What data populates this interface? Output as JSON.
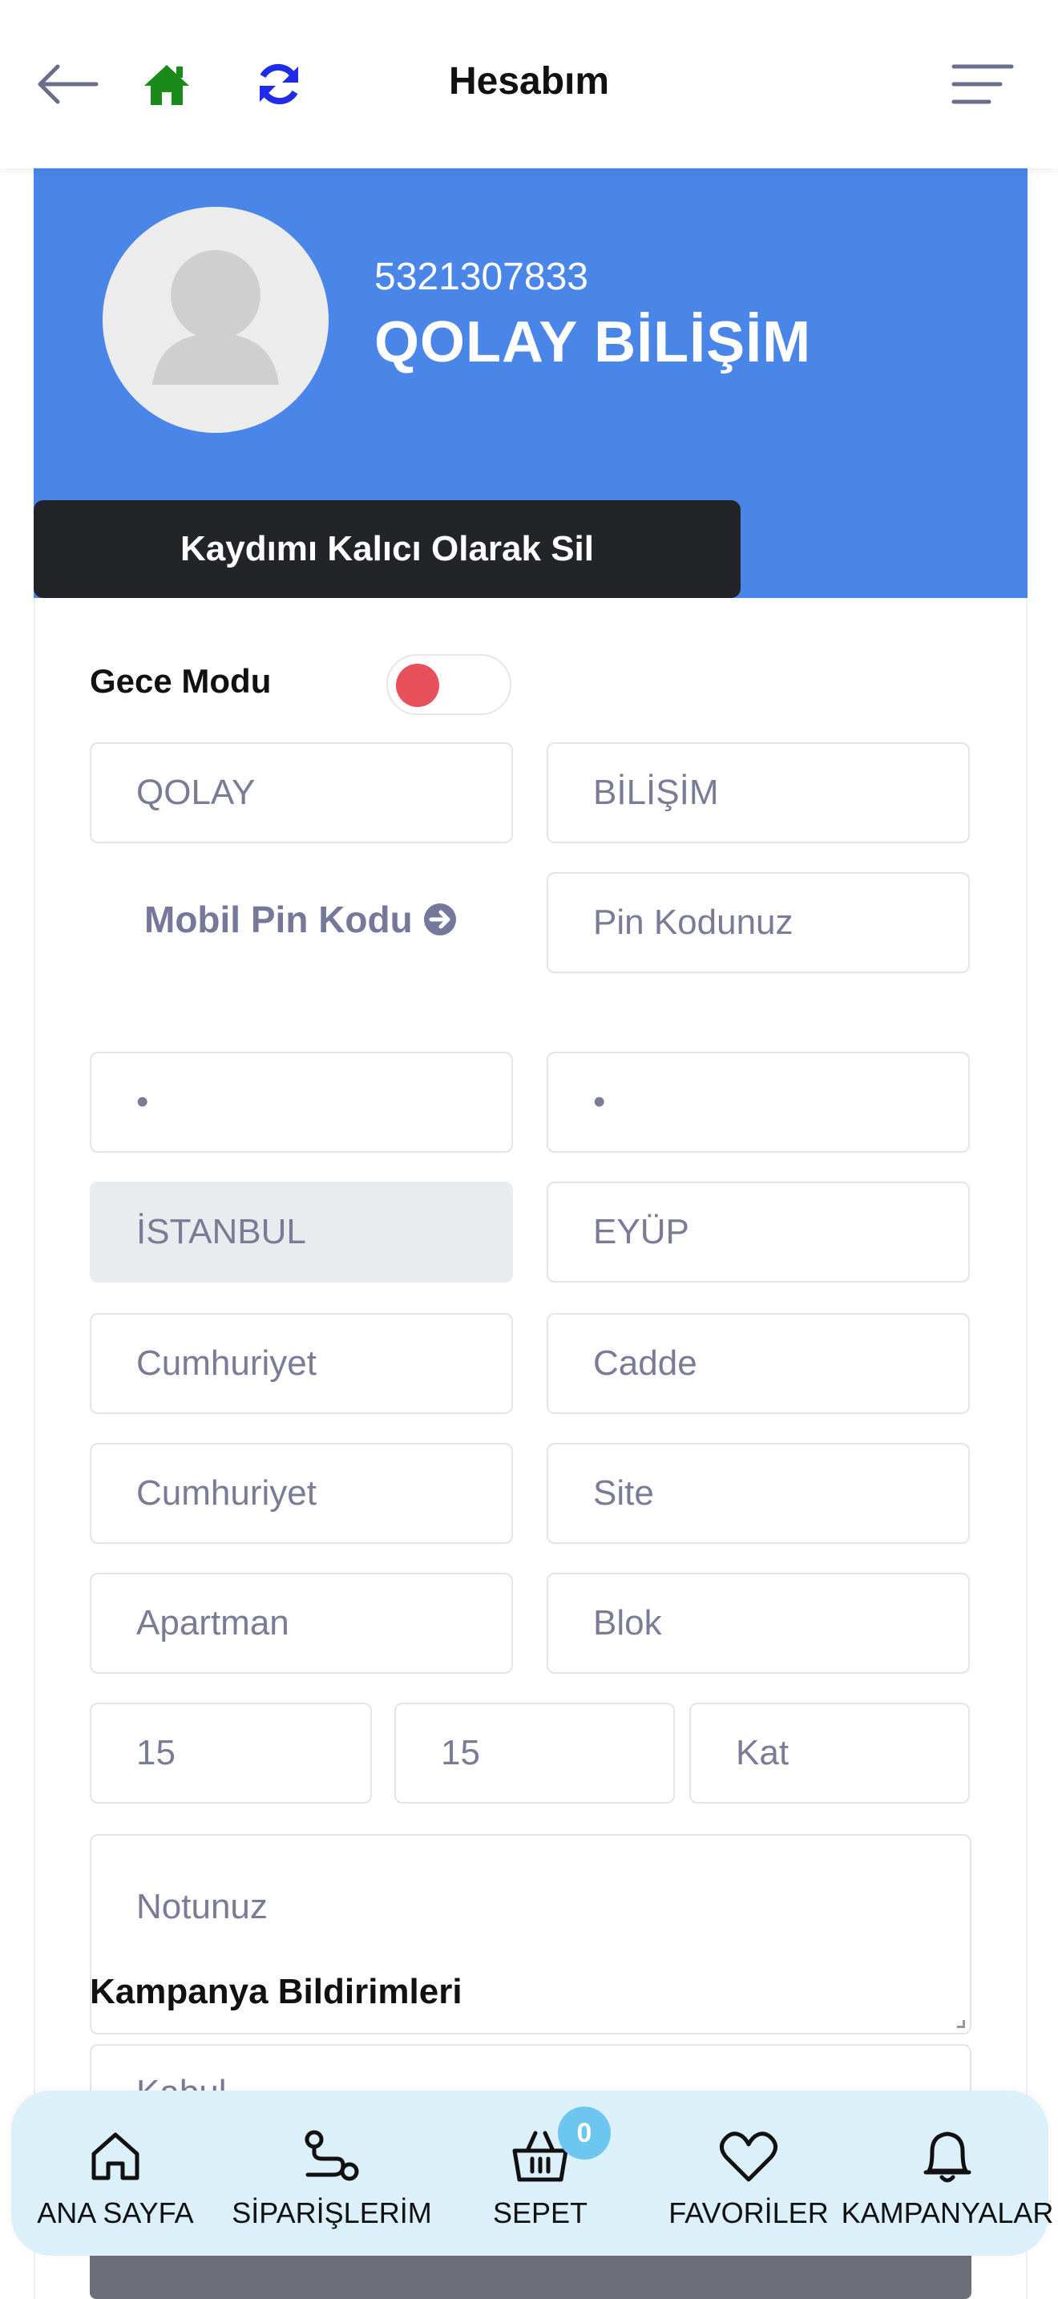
{
  "header": {
    "title": "Hesabım",
    "back_icon": "arrow-left",
    "home_icon": "home",
    "refresh_icon": "refresh",
    "menu_icon": "hamburger-menu",
    "colors": {
      "home": "#1a8a1a",
      "refresh": "#1f2be6",
      "muted": "#6b6e8a"
    }
  },
  "profile": {
    "phone": "5321307833",
    "name": "QOLAY BİLİŞİM",
    "delete_button": "Kaydımı Kalıcı Olarak Sil",
    "card_color": "#4a86e8"
  },
  "form": {
    "night_mode_label": "Gece Modu",
    "night_mode_toggle_color": "#e8505b",
    "first_name": "QOLAY",
    "last_name": "BİLİŞİM",
    "pin_link": "Mobil Pin Kodu",
    "pin_placeholder": "Pin Kodunuz",
    "field_a": "•",
    "field_b": "•",
    "city": "İSTANBUL",
    "district": "EYÜP",
    "neighborhood": "Cumhuriyet",
    "street": "Cadde",
    "neighborhood2": "Cumhuriyet",
    "site": "Site",
    "apartment": "Apartman",
    "block": "Blok",
    "no1": "15",
    "no2": "15",
    "floor": "Kat",
    "note_placeholder": "Notunuz",
    "campaign_label": "Kampanya Bildirimleri",
    "campaign_value": "Kabul"
  },
  "bottom_nav": {
    "items": [
      {
        "label": "ANA SAYFA",
        "icon": "home-outline"
      },
      {
        "label": "SİPARİŞLERİM",
        "icon": "route"
      },
      {
        "label": "SEPET",
        "icon": "basket",
        "badge": "0"
      },
      {
        "label": "FAVORİLER",
        "icon": "heart-outline"
      },
      {
        "label": "KAMPANYALAR",
        "icon": "bell-outline"
      }
    ],
    "badge_color": "#6cc6ef"
  }
}
